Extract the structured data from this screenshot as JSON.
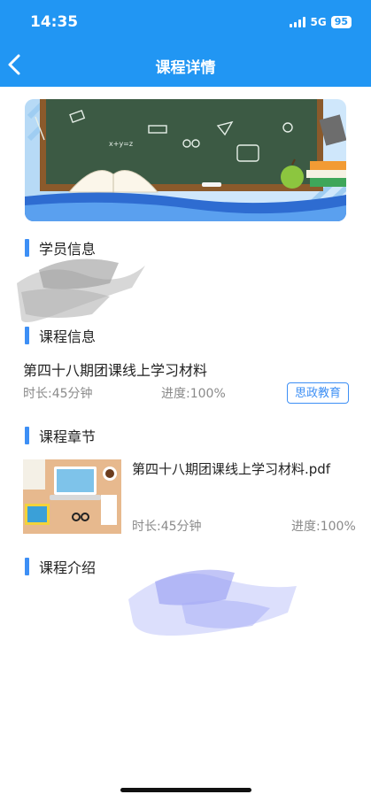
{
  "status_bar": {
    "time": "14:35",
    "network": "5G",
    "battery": "95"
  },
  "nav": {
    "title": "课程详情",
    "back_icon": "chevron-left-icon"
  },
  "student_section": {
    "title": "学员信息"
  },
  "course_section": {
    "title": "课程信息",
    "course_name": "第四十八期团课线上学习材料",
    "duration": "时长:45分钟",
    "progress": "进度:100%",
    "category_tag": "思政教育"
  },
  "chapters_section": {
    "title": "课程章节",
    "items": [
      {
        "name": "第四十八期团课线上学习材料.pdf",
        "duration": "时长:45分钟",
        "progress": "进度:100%"
      }
    ]
  },
  "intro_section": {
    "title": "课程介绍"
  },
  "colors": {
    "header_blue": "#2196f3",
    "accent_blue": "#3d8ff5",
    "meta_gray": "#8a8a8a"
  }
}
